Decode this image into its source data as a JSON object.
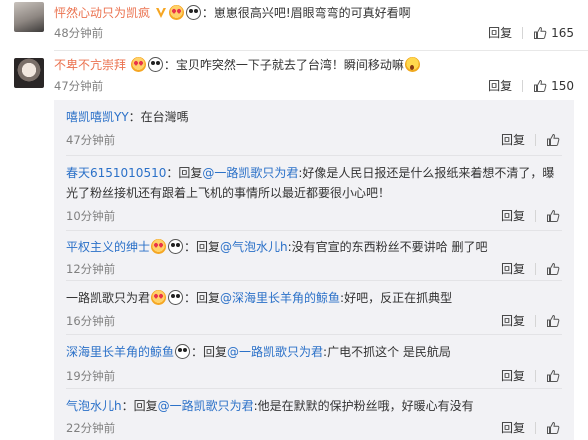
{
  "comments": [
    {
      "user": "怦然心动只为凯疯",
      "text": "：崽崽很高兴吧!眉眼弯弯的可真好看啊",
      "time": "48分钟前",
      "reply_label": "回复",
      "likes": "165",
      "badges": [
        "verified-v-icon",
        "love-emoji-icon",
        "panda-emoji-icon"
      ]
    },
    {
      "user": "不卑不亢崇拜",
      "text": "：宝贝咋突然一下子就去了台湾！瞬间移动嘛",
      "time": "47分钟前",
      "reply_label": "回复",
      "likes": "150",
      "badges": [
        "love-emoji-icon",
        "panda-emoji-icon"
      ]
    }
  ],
  "replies": [
    {
      "user": "嘻凯嘻凯YY",
      "text": "：在台灣嗎",
      "time": "47分钟前",
      "reply_label": "回复",
      "likes": ""
    },
    {
      "user": "春天6151010510",
      "prefix": "：回复",
      "mention": "@一路凯歌只为君",
      "text": ":好像是人民日报还是什么报纸来着想不清了，曝光了粉丝接机还有跟着上飞机的事情所以最近都要很小心吧！",
      "time": "10分钟前",
      "reply_label": "回复",
      "likes": ""
    },
    {
      "user": "平权主义的绅士",
      "prefix": "：回复",
      "mention": "@气泡水儿h",
      "text": ":没有官宣的东西粉丝不要讲哈 删了吧",
      "time": "12分钟前",
      "reply_label": "回复",
      "likes": ""
    },
    {
      "user": "一路凯歌只为君",
      "prefix": "：回复",
      "mention": "@深海里长羊角的鲸鱼",
      "text": ":好吧，反正在抓典型",
      "time": "16分钟前",
      "reply_label": "回复",
      "likes": ""
    },
    {
      "user": "深海里长羊角的鲸鱼",
      "prefix": "：回复",
      "mention": "@一路凯歌只为君",
      "text": ":广电不抓这个 是民航局",
      "time": "19分钟前",
      "reply_label": "回复",
      "likes": ""
    },
    {
      "user": "气泡水儿h",
      "prefix": "：回复",
      "mention": "@一路凯歌只为君",
      "text": ":他是在默默的保护粉丝哦，好暖心有没有",
      "time": "22分钟前",
      "reply_label": "回复",
      "likes": ""
    }
  ],
  "colors": {
    "username_orange": "#eb7350",
    "link_blue": "#2a70c8",
    "time_gray": "#808080",
    "reply_bg": "#f2f2f5"
  }
}
